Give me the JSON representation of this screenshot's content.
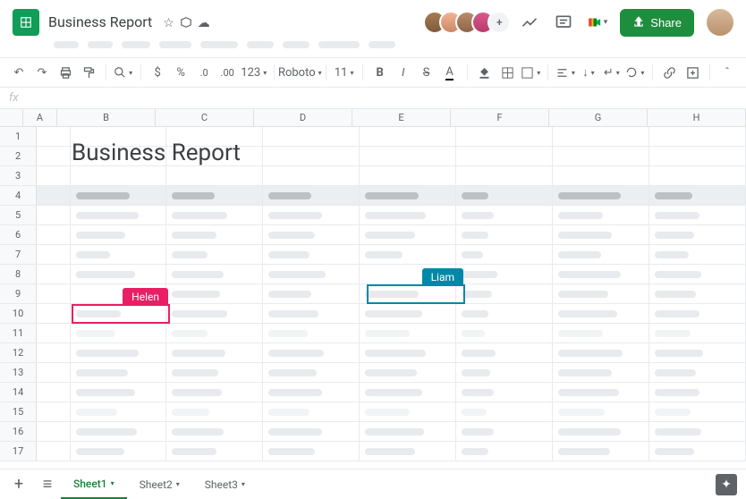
{
  "header": {
    "doc_title": "Business Report",
    "share_label": "Share",
    "overflow_label": "+"
  },
  "toolbar": {
    "font_name": "Roboto",
    "font_size": "11",
    "zoom_group": "123"
  },
  "formula_bar": {
    "fx": "fx"
  },
  "columns": [
    "A",
    "B",
    "C",
    "D",
    "E",
    "F",
    "G",
    "H"
  ],
  "rows": [
    "1",
    "2",
    "3",
    "4",
    "5",
    "6",
    "7",
    "8",
    "9",
    "10",
    "11",
    "12",
    "13",
    "14",
    "15",
    "16",
    "17"
  ],
  "sheet_title": "Business Report",
  "collaborators": {
    "helen": "Helen",
    "liam": "Liam"
  },
  "tabs": {
    "sheet1": "Sheet1",
    "sheet2": "Sheet2",
    "sheet3": "Sheet3"
  }
}
